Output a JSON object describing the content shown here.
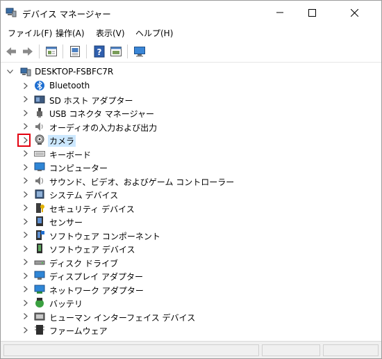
{
  "window": {
    "title": "デバイス マネージャー"
  },
  "menu": [
    "ファイル(F)",
    "操作(A)",
    "表示(V)",
    "ヘルプ(H)"
  ],
  "toolbar": [
    "back-icon",
    "forward-icon",
    "properties-icon",
    "update-icon",
    "help-icon",
    "view-icon",
    "monitor-icon"
  ],
  "tree": {
    "root": {
      "label": "DESKTOP-FSBFC7R",
      "expanded": true
    },
    "items": [
      {
        "label": "Bluetooth",
        "icon": "bluetooth-icon"
      },
      {
        "label": "SD ホスト アダプター",
        "icon": "sd-host-icon"
      },
      {
        "label": "USB コネクタ マネージャー",
        "icon": "usb-connector-icon"
      },
      {
        "label": "オーディオの入力および出力",
        "icon": "audio-io-icon"
      },
      {
        "label": "カメラ",
        "icon": "camera-icon",
        "selected": true
      },
      {
        "label": "キーボード",
        "icon": "keyboard-icon"
      },
      {
        "label": "コンピューター",
        "icon": "computer-icon"
      },
      {
        "label": "サウンド、ビデオ、およびゲーム コントローラー",
        "icon": "sound-icon"
      },
      {
        "label": "システム デバイス",
        "icon": "system-device-icon"
      },
      {
        "label": "セキュリティ デバイス",
        "icon": "security-device-icon"
      },
      {
        "label": "センサー",
        "icon": "sensor-icon"
      },
      {
        "label": "ソフトウェア コンポーネント",
        "icon": "software-component-icon"
      },
      {
        "label": "ソフトウェア デバイス",
        "icon": "software-device-icon"
      },
      {
        "label": "ディスク ドライブ",
        "icon": "disk-drive-icon"
      },
      {
        "label": "ディスプレイ アダプター",
        "icon": "display-adapter-icon"
      },
      {
        "label": "ネットワーク アダプター",
        "icon": "network-adapter-icon"
      },
      {
        "label": "バッテリ",
        "icon": "battery-icon"
      },
      {
        "label": "ヒューマン インターフェイス デバイス",
        "icon": "hid-icon"
      },
      {
        "label": "ファームウェア",
        "icon": "firmware-icon"
      }
    ]
  },
  "colors": {
    "selection": "#cce8ff",
    "highlight": "#e3000f"
  }
}
